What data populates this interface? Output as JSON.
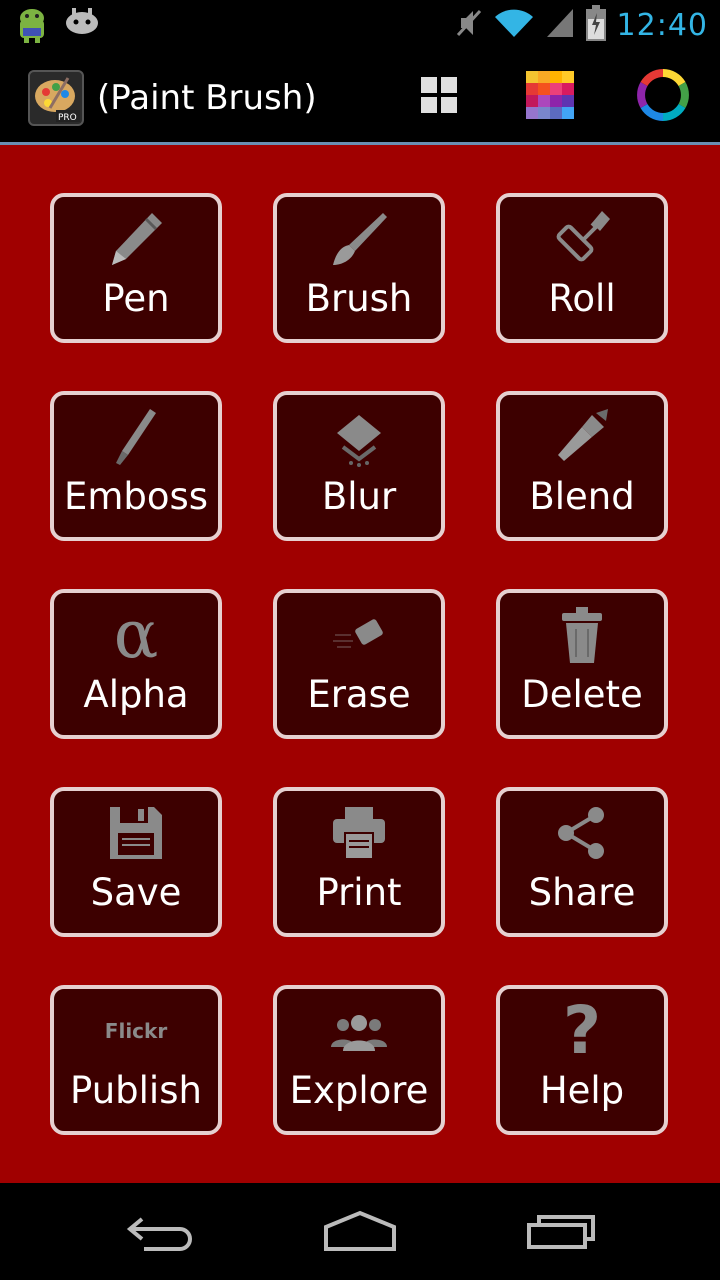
{
  "status_bar": {
    "time": "12:40",
    "icons": [
      "android-icon",
      "game-controller-icon",
      "mute-icon",
      "wifi-icon",
      "signal-icon",
      "battery-icon"
    ]
  },
  "action_bar": {
    "title": "(Paint Brush)",
    "app_badge": "PRO",
    "actions": [
      "grid-view-icon",
      "color-palette-icon",
      "color-wheel-icon"
    ]
  },
  "tools": [
    {
      "label": "Pen",
      "icon": "pen-icon"
    },
    {
      "label": "Brush",
      "icon": "brush-icon"
    },
    {
      "label": "Roll",
      "icon": "roller-icon"
    },
    {
      "label": "Emboss",
      "icon": "knife-icon"
    },
    {
      "label": "Blur",
      "icon": "blur-icon"
    },
    {
      "label": "Blend",
      "icon": "blend-brush-icon"
    },
    {
      "label": "Alpha",
      "icon": "alpha-icon",
      "glyph": "α"
    },
    {
      "label": "Erase",
      "icon": "eraser-icon"
    },
    {
      "label": "Delete",
      "icon": "trash-icon"
    },
    {
      "label": "Save",
      "icon": "floppy-disk-icon"
    },
    {
      "label": "Print",
      "icon": "printer-icon"
    },
    {
      "label": "Share",
      "icon": "share-icon"
    },
    {
      "label": "Publish",
      "icon": "flickr-icon",
      "glyph": "Flickr"
    },
    {
      "label": "Explore",
      "icon": "people-icon"
    },
    {
      "label": "Help",
      "icon": "question-icon",
      "glyph": "?"
    }
  ],
  "nav_bar": {
    "buttons": [
      "back-icon",
      "home-icon",
      "recent-apps-icon"
    ]
  },
  "colors": {
    "background": "#a00000",
    "tile": "#3d0000",
    "tile_border": "#e6d0d0",
    "accent": "#33b5e5"
  }
}
